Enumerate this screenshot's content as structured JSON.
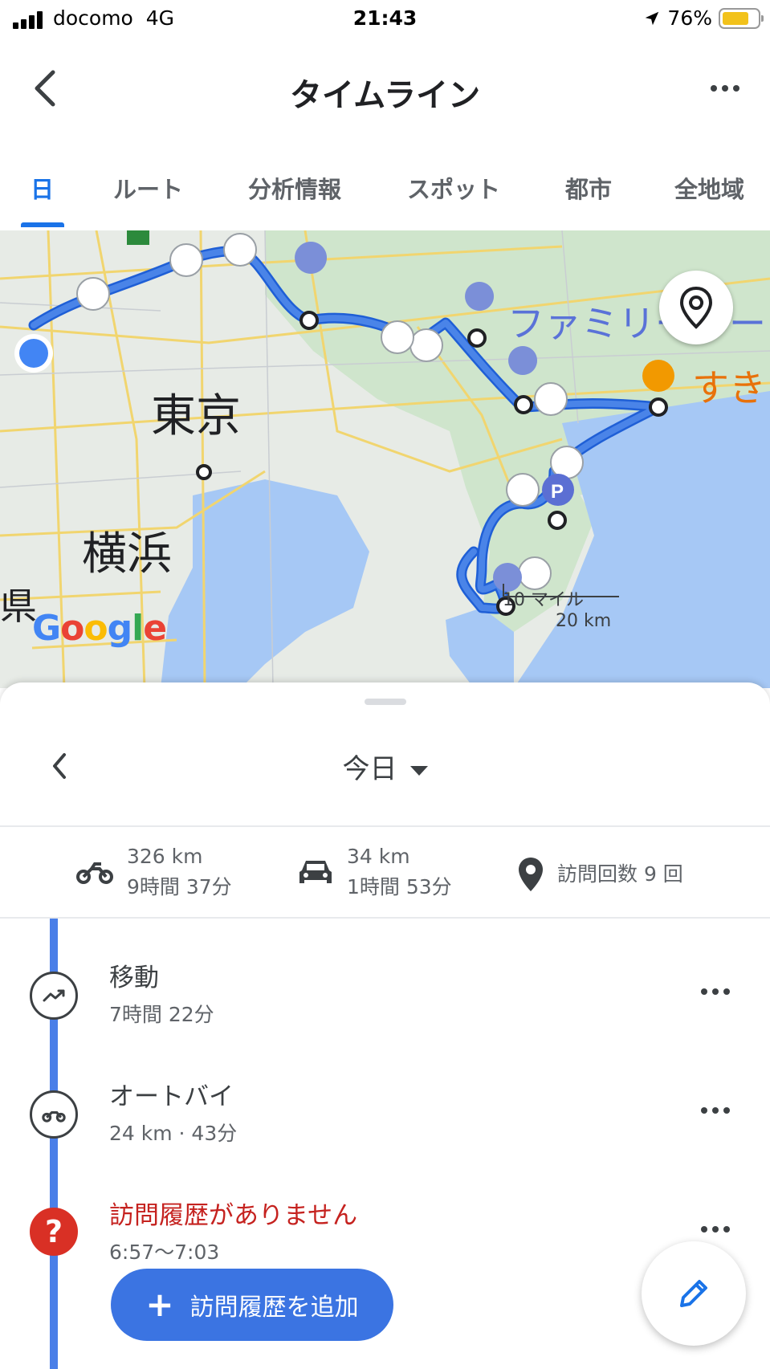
{
  "status_bar": {
    "carrier": "docomo",
    "network": "4G",
    "time": "21:43",
    "battery": "76%",
    "battery_level": 0.76
  },
  "app_bar": {
    "title": "タイムライン",
    "back_icon": "chevron-left-icon",
    "more_icon": "more-horiz-icon"
  },
  "tabs": [
    {
      "label": "日",
      "active": true
    },
    {
      "label": "ルート",
      "active": false
    },
    {
      "label": "分析情報",
      "active": false
    },
    {
      "label": "スポット",
      "active": false
    },
    {
      "label": "都市",
      "active": false
    },
    {
      "label": "全地域",
      "active": false
    }
  ],
  "map": {
    "city_labels": [
      "東京",
      "横浜"
    ],
    "poi_labels": [
      "ファミリーマー",
      "すき"
    ],
    "edge_label": "県",
    "scale_miles": "10 マイル",
    "scale_km": "20 km",
    "logo": "Google",
    "route_color": "#4a84e8"
  },
  "sheet": {
    "date_label": "今日",
    "summary": [
      {
        "icon": "motorcycle-icon",
        "distance": "326 km",
        "duration": "9時間 37分"
      },
      {
        "icon": "car-icon",
        "distance": "34 km",
        "duration": "1時間 53分"
      },
      {
        "icon": "place-icon",
        "text": "訪問回数 9 回"
      }
    ],
    "timeline": [
      {
        "title": "移動",
        "subtitle": "7時間 22分",
        "icon": "trending-icon"
      },
      {
        "title": "オートバイ",
        "subtitle": "24 km · 43分",
        "icon": "motorcycle-icon"
      },
      {
        "title": "訪問履歴がありません",
        "subtitle": "6:57〜7:03",
        "icon": "question-icon",
        "error": true
      }
    ],
    "add_button": "訪問履歴を追加",
    "fab_icon": "edit-pencil-icon"
  }
}
